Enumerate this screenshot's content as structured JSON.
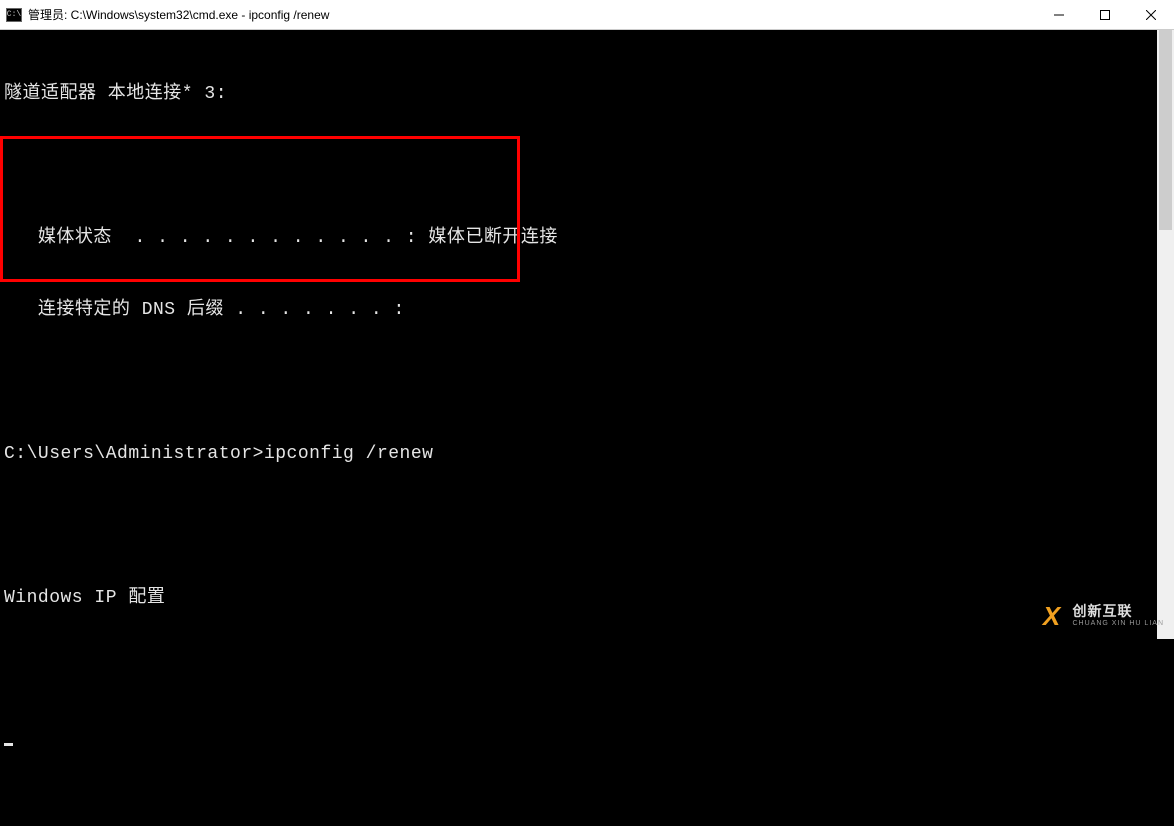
{
  "titlebar": {
    "icon_label": "C:\\",
    "title": "管理员: C:\\Windows\\system32\\cmd.exe - ipconfig  /renew"
  },
  "terminal": {
    "lines": [
      "隧道适配器 本地连接* 3:",
      "",
      "   媒体状态  . . . . . . . . . . . . : 媒体已断开连接",
      "   连接特定的 DNS 后缀 . . . . . . . :",
      "",
      "C:\\Users\\Administrator>ipconfig /renew",
      "",
      "Windows IP 配置",
      "",
      ""
    ]
  },
  "watermark": {
    "logo": "X",
    "cn": "创新互联",
    "en": "CHUANG XIN HU LIAN"
  }
}
